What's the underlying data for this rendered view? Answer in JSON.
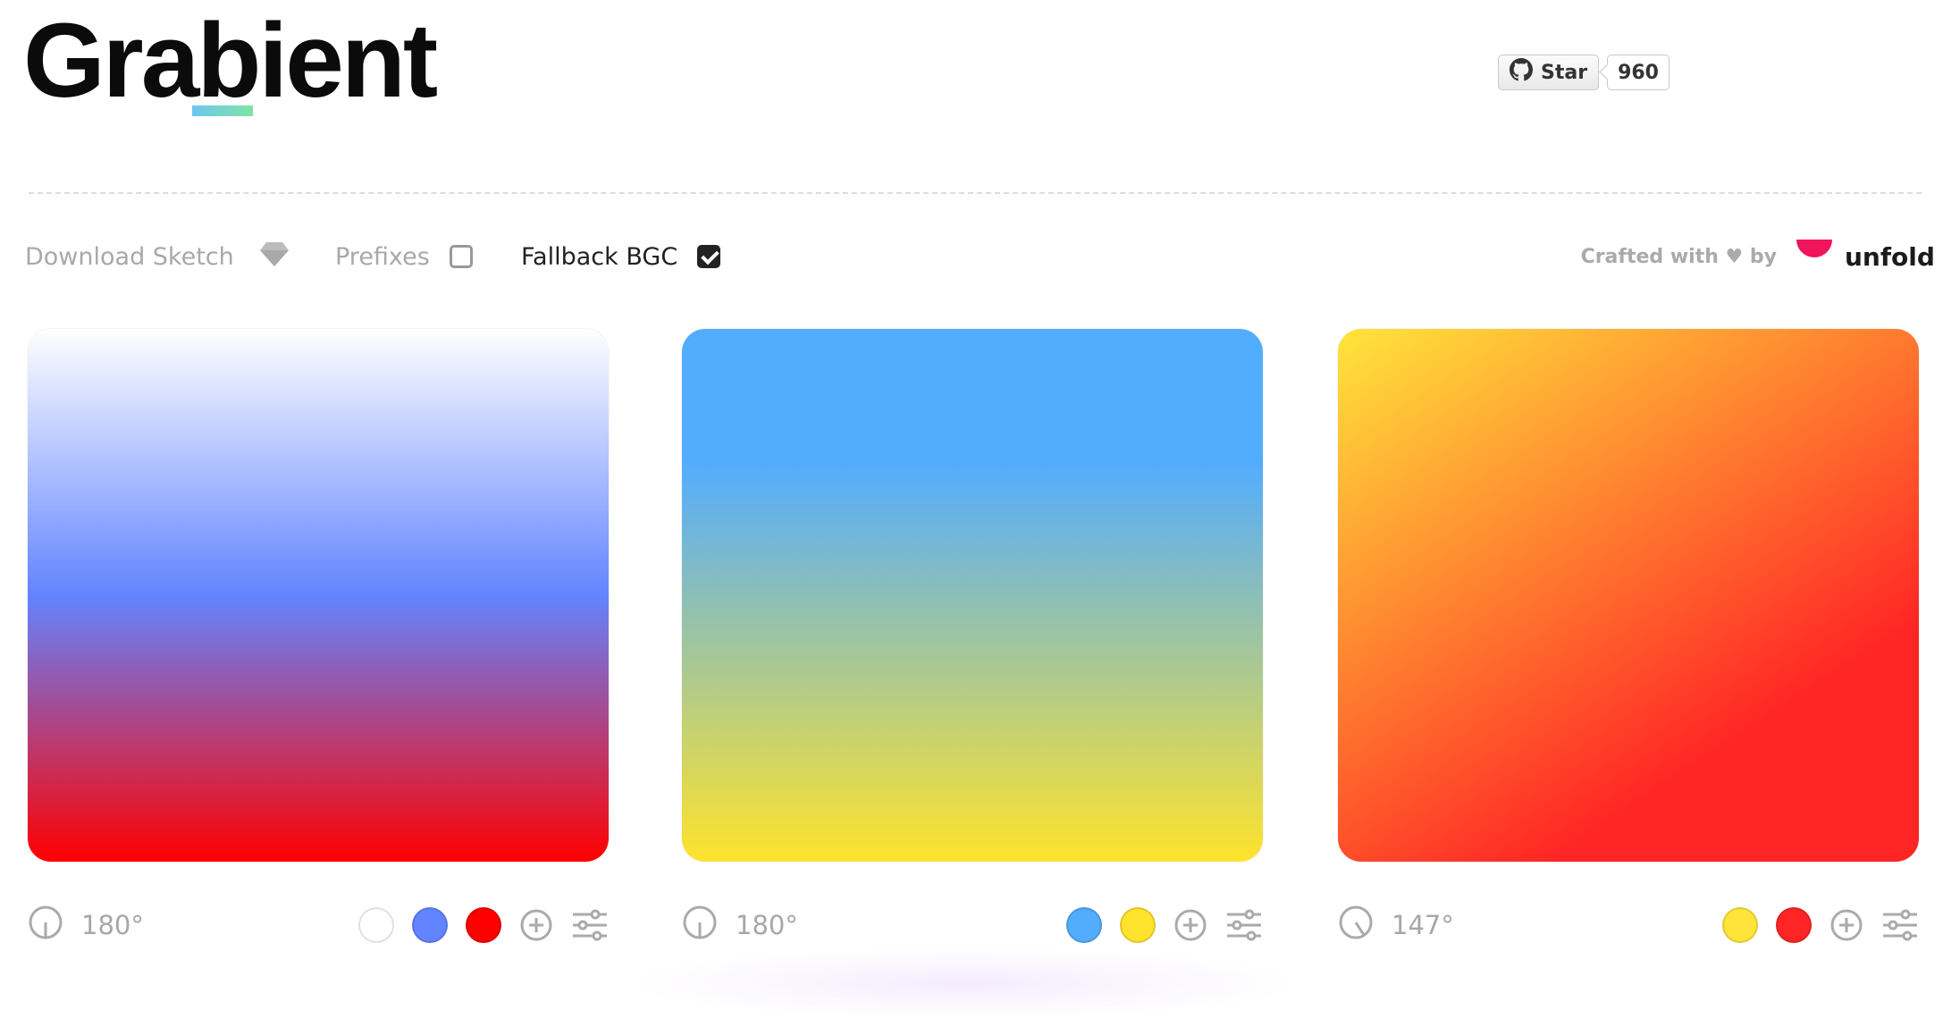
{
  "brand": {
    "name": "Grabient"
  },
  "github": {
    "star_label": "Star",
    "count": "960",
    "icon": "github-icon"
  },
  "options": {
    "download_label": "Download Sketch",
    "prefixes_label": "Prefixes",
    "prefixes_checked": false,
    "fallback_label": "Fallback BGC",
    "fallback_checked": true
  },
  "credits": {
    "crafted_label": "Crafted with ♥ by",
    "company": "unfold",
    "accent": "#f0145a"
  },
  "gradients": [
    {
      "angle_label": "180°",
      "angle_deg": 180,
      "stops": [
        "#ffffff",
        "#6284ff",
        "#ff0000"
      ],
      "positions": [
        0,
        50,
        100
      ]
    },
    {
      "angle_label": "180°",
      "angle_deg": 180,
      "stops": [
        "#52acff",
        "#ffe32c"
      ],
      "positions": [
        25,
        100
      ]
    },
    {
      "angle_label": "147°",
      "angle_deg": 147,
      "stops": [
        "#ffe53b",
        "#ff2525"
      ],
      "positions": [
        0,
        74
      ]
    }
  ]
}
